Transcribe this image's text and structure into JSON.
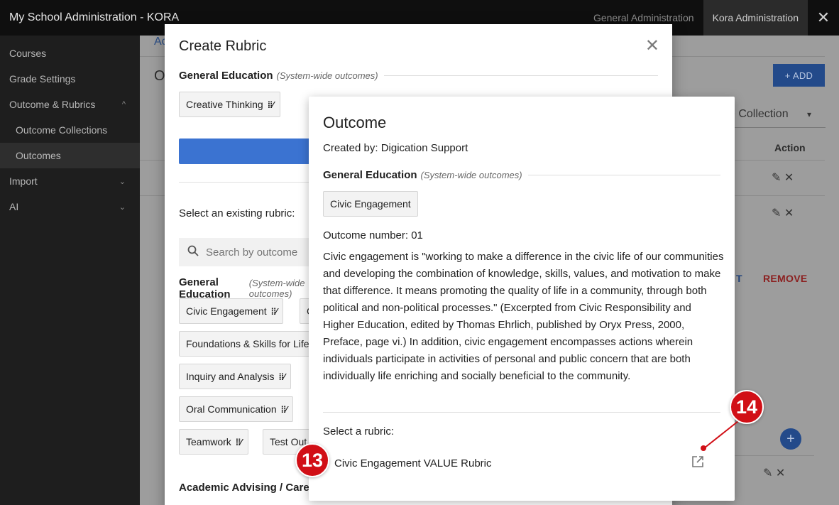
{
  "topbar": {
    "app_title": "My School Administration - KORA",
    "nav_general": "General Administration",
    "nav_kora": "Kora Administration",
    "close": "✕"
  },
  "sidebar": {
    "items": [
      {
        "label": "Courses"
      },
      {
        "label": "Grade Settings"
      },
      {
        "label": "Outcome & Rubrics",
        "chev": "^"
      },
      {
        "label": "Outcome Collections"
      },
      {
        "label": "Outcomes"
      },
      {
        "label": "Import",
        "chev": "⌄"
      },
      {
        "label": "AI",
        "chev": "⌄"
      }
    ]
  },
  "background": {
    "crumb": "Ac",
    "heading": "O",
    "add_label": "+ ADD",
    "collection_label": "e Collection",
    "collection_caret": "▾",
    "action_header": "Action",
    "row_icons": "✎  ✕",
    "edit_fragment": "T",
    "remove_label": "REMOVE",
    "fab": "+"
  },
  "dialog": {
    "title": "Create Rubric",
    "close": "✕",
    "top_section": {
      "name": "General Education",
      "scope": "(System-wide outcomes)"
    },
    "top_chip": "Creative Thinking",
    "existing_label": "Select an existing rubric:",
    "search_placeholder": "Search by outcome",
    "list_section": {
      "name": "General Education",
      "scope": "(System-wide outcomes)"
    },
    "chips": [
      "Civic Engagement",
      "C",
      "Foundations & Skills for Life",
      "Inquiry and Analysis",
      "Oral Communication",
      "Teamwork",
      "Test Out"
    ],
    "next_section": "Academic Advising / Career"
  },
  "popover": {
    "title": "Outcome",
    "created_by": "Created by: Digication Support",
    "section": {
      "name": "General Education",
      "scope": "(System-wide outcomes)"
    },
    "chip": "Civic Engagement",
    "number": "Outcome number: 01",
    "description": "Civic engagement is \"working to make a difference in the civic life of our communities and developing the combination of knowledge, skills, values, and motivation to make that difference. It means promoting the quality of life in a community, through both political and non-political processes.\" (Excerpted from Civic Responsibility and Higher Education, edited by Thomas Ehrlich, published by Oryx Press, 2000, Preface, page vi.) In addition, civic engagement encompasses actions wherein individuals participate in activities of personal and public concern that are both individually life enriching and socially beneficial to the community.",
    "select_label": "Select a rubric:",
    "rubric_name": "Civic Engagement VALUE Rubric"
  },
  "markers": {
    "m13": "13",
    "m14": "14"
  },
  "colors": {
    "marker": "#d10f16",
    "primary": "#3b73d1"
  }
}
